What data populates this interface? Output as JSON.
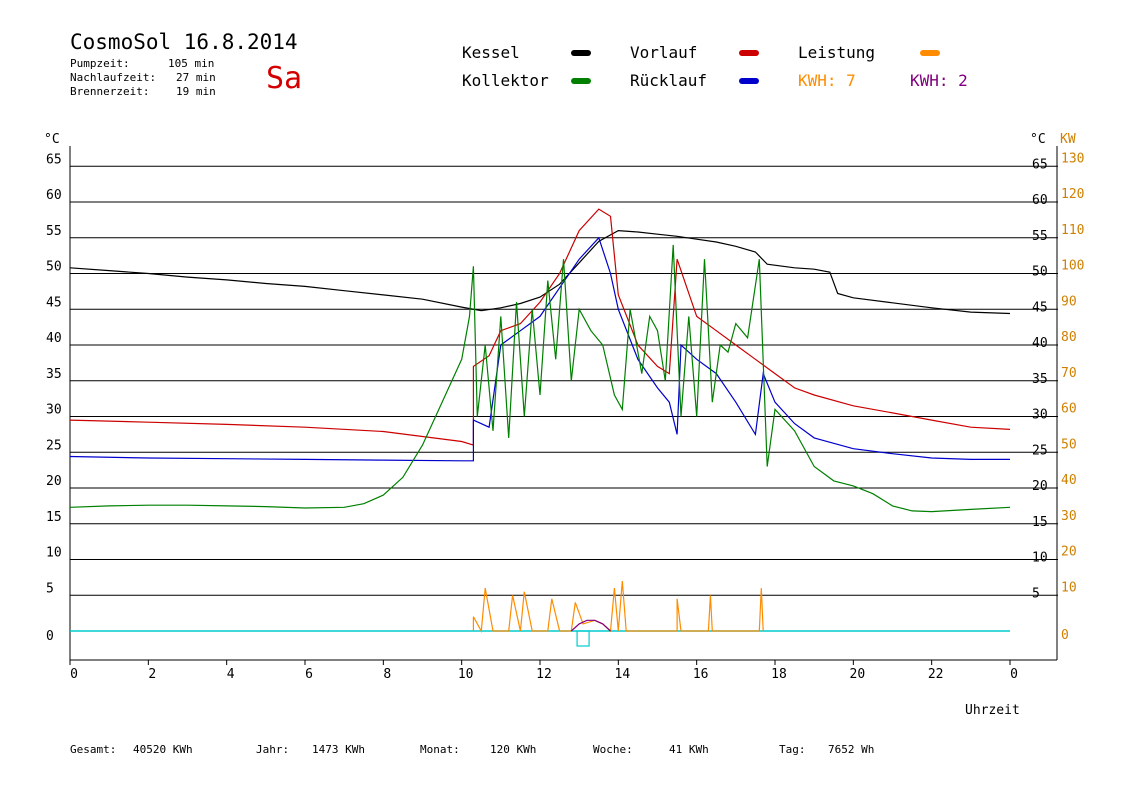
{
  "header": {
    "title": "CosmoSol 16.8.2014",
    "day": "Sa",
    "pump_label": "Pumpzeit:",
    "pump_value": "105 min",
    "after_label": "Nachlaufzeit:",
    "after_value": "27 min",
    "burner_label": "Brennerzeit:",
    "burner_value": "19 min"
  },
  "legend": {
    "kessel": "Kessel",
    "kollektor": "Kollektor",
    "vorlauf": "Vorlauf",
    "ruecklauf": "Rücklauf",
    "leistung": "Leistung",
    "kwh1": "KWH: 7",
    "kwh2": "KWH: 2"
  },
  "colors": {
    "kessel": "#000000",
    "kollektor": "#008000",
    "vorlauf": "#cc0000",
    "ruecklauf": "#0000cc",
    "leistung": "#ff8c00",
    "kwh2": "#800080",
    "baseline": "#00cccc",
    "kw_axis": "#d08000"
  },
  "footer": {
    "gesamt_label": "Gesamt:",
    "gesamt_value": "40520 KWh",
    "jahr_label": "Jahr:",
    "jahr_value": "1473 KWh",
    "monat_label": "Monat:",
    "monat_value": "120 KWh",
    "woche_label": "Woche:",
    "woche_value": "41 KWh",
    "tag_label": "Tag:",
    "tag_value": "7652 Wh"
  },
  "chart_data": {
    "type": "line",
    "xlabel": "Uhrzeit",
    "ylabel_left": "°C",
    "ylabel_right_temp": "°C",
    "ylabel_right_power": "KW",
    "xlim": [
      0,
      24
    ],
    "ylim": [
      -5,
      70
    ],
    "x_ticks": [
      "0",
      "2",
      "4",
      "6",
      "8",
      "10",
      "12",
      "14",
      "16",
      "18",
      "20",
      "22",
      "0"
    ],
    "y_ticks_left": [
      0,
      5,
      10,
      15,
      20,
      25,
      30,
      35,
      40,
      45,
      50,
      55,
      60,
      65
    ],
    "y_ticks_right_temp": [
      5,
      10,
      15,
      20,
      25,
      30,
      35,
      40,
      45,
      50,
      55,
      60,
      65
    ],
    "y_ticks_right_power": [
      0,
      10,
      20,
      30,
      40,
      50,
      60,
      70,
      80,
      90,
      100,
      110,
      120,
      130
    ],
    "grid": true,
    "series": [
      {
        "name": "Kessel",
        "color": "#000000",
        "points": [
          [
            0,
            50.8
          ],
          [
            1,
            50.4
          ],
          [
            2,
            50.0
          ],
          [
            3,
            49.5
          ],
          [
            4,
            49.1
          ],
          [
            5,
            48.6
          ],
          [
            6,
            48.2
          ],
          [
            7,
            47.6
          ],
          [
            8,
            47.0
          ],
          [
            9,
            46.4
          ],
          [
            10,
            45.3
          ],
          [
            10.5,
            44.8
          ],
          [
            11,
            45.2
          ],
          [
            11.5,
            45.8
          ],
          [
            12,
            46.7
          ],
          [
            12.5,
            48.5
          ],
          [
            13,
            51.5
          ],
          [
            13.5,
            54.5
          ],
          [
            14,
            56.0
          ],
          [
            14.5,
            55.8
          ],
          [
            15,
            55.5
          ],
          [
            15.5,
            55.2
          ],
          [
            16,
            54.8
          ],
          [
            16.5,
            54.4
          ],
          [
            17,
            53.8
          ],
          [
            17.5,
            53.0
          ],
          [
            17.8,
            51.3
          ],
          [
            18.5,
            50.8
          ],
          [
            19,
            50.6
          ],
          [
            19.4,
            50.2
          ],
          [
            19.6,
            47.2
          ],
          [
            20,
            46.6
          ],
          [
            21,
            45.9
          ],
          [
            22,
            45.2
          ],
          [
            23,
            44.6
          ],
          [
            24,
            44.4
          ]
        ]
      },
      {
        "name": "Vorlauf",
        "color": "#cc0000",
        "points": [
          [
            0,
            29.5
          ],
          [
            2,
            29.2
          ],
          [
            4,
            28.9
          ],
          [
            6,
            28.5
          ],
          [
            8,
            27.9
          ],
          [
            9,
            27.2
          ],
          [
            10,
            26.5
          ],
          [
            10.3,
            26.0
          ],
          [
            10.3,
            37.0
          ],
          [
            10.7,
            38.5
          ],
          [
            11,
            42
          ],
          [
            11.5,
            43
          ],
          [
            12,
            46
          ],
          [
            12.5,
            50
          ],
          [
            13,
            56
          ],
          [
            13.5,
            59
          ],
          [
            13.8,
            58
          ],
          [
            14,
            47
          ],
          [
            14.5,
            40
          ],
          [
            15,
            37
          ],
          [
            15.3,
            36
          ],
          [
            15.5,
            52
          ],
          [
            16,
            44
          ],
          [
            16.5,
            42
          ],
          [
            17,
            40
          ],
          [
            17.5,
            38
          ],
          [
            18,
            36
          ],
          [
            18.5,
            34
          ],
          [
            19,
            33
          ],
          [
            20,
            31.5
          ],
          [
            21,
            30.5
          ],
          [
            22,
            29.5
          ],
          [
            23,
            28.5
          ],
          [
            24,
            28.2
          ]
        ]
      },
      {
        "name": "Rücklauf",
        "color": "#0000cc",
        "points": [
          [
            0,
            24.4
          ],
          [
            2,
            24.2
          ],
          [
            4,
            24.1
          ],
          [
            6,
            24.0
          ],
          [
            8,
            23.9
          ],
          [
            10,
            23.8
          ],
          [
            10.3,
            23.8
          ],
          [
            10.3,
            29.5
          ],
          [
            10.7,
            28.5
          ],
          [
            11,
            40
          ],
          [
            11.5,
            42
          ],
          [
            12,
            44
          ],
          [
            12.5,
            48
          ],
          [
            13,
            52
          ],
          [
            13.5,
            55
          ],
          [
            13.8,
            50
          ],
          [
            14,
            45
          ],
          [
            14.5,
            38
          ],
          [
            15,
            34
          ],
          [
            15.3,
            32
          ],
          [
            15.5,
            27.5
          ],
          [
            15.6,
            40
          ],
          [
            16,
            38
          ],
          [
            16.5,
            36
          ],
          [
            17,
            32
          ],
          [
            17.5,
            27.5
          ],
          [
            17.7,
            36
          ],
          [
            18,
            32
          ],
          [
            18.5,
            29
          ],
          [
            19,
            27
          ],
          [
            20,
            25.5
          ],
          [
            21,
            24.8
          ],
          [
            22,
            24.2
          ],
          [
            23,
            24.0
          ],
          [
            24,
            24.0
          ]
        ]
      },
      {
        "name": "Kollektor",
        "color": "#008000",
        "points": [
          [
            0,
            17.3
          ],
          [
            1,
            17.5
          ],
          [
            2,
            17.6
          ],
          [
            3,
            17.6
          ],
          [
            4,
            17.5
          ],
          [
            5,
            17.4
          ],
          [
            6,
            17.2
          ],
          [
            7,
            17.3
          ],
          [
            7.5,
            17.8
          ],
          [
            8,
            19
          ],
          [
            8.5,
            21.5
          ],
          [
            9,
            26
          ],
          [
            9.5,
            32
          ],
          [
            10,
            38
          ],
          [
            10.2,
            44
          ],
          [
            10.3,
            51
          ],
          [
            10.4,
            30
          ],
          [
            10.6,
            40
          ],
          [
            10.8,
            28
          ],
          [
            11,
            44
          ],
          [
            11.2,
            27
          ],
          [
            11.4,
            46
          ],
          [
            11.6,
            30
          ],
          [
            11.8,
            45
          ],
          [
            12,
            33
          ],
          [
            12.2,
            49
          ],
          [
            12.4,
            38
          ],
          [
            12.6,
            52
          ],
          [
            12.8,
            35
          ],
          [
            13,
            45
          ],
          [
            13.3,
            42
          ],
          [
            13.6,
            40
          ],
          [
            13.9,
            33
          ],
          [
            14.1,
            31
          ],
          [
            14.3,
            45
          ],
          [
            14.6,
            36
          ],
          [
            14.8,
            44
          ],
          [
            15,
            42
          ],
          [
            15.2,
            35
          ],
          [
            15.4,
            54
          ],
          [
            15.6,
            30
          ],
          [
            15.8,
            44
          ],
          [
            16,
            30
          ],
          [
            16.2,
            52
          ],
          [
            16.4,
            32
          ],
          [
            16.6,
            40
          ],
          [
            16.8,
            39
          ],
          [
            17,
            43
          ],
          [
            17.3,
            41
          ],
          [
            17.6,
            52
          ],
          [
            17.8,
            23
          ],
          [
            18,
            31
          ],
          [
            18.5,
            28
          ],
          [
            19,
            23
          ],
          [
            19.5,
            21
          ],
          [
            20,
            20.3
          ],
          [
            20.5,
            19.2
          ],
          [
            21,
            17.5
          ],
          [
            21.5,
            16.8
          ],
          [
            22,
            16.7
          ],
          [
            23,
            17.0
          ],
          [
            24,
            17.3
          ]
        ]
      },
      {
        "name": "Leistung",
        "color": "#ff8c00",
        "axis": "right_power",
        "points": [
          [
            10.3,
            0
          ],
          [
            10.3,
            4
          ],
          [
            10.5,
            0
          ],
          [
            10.6,
            12
          ],
          [
            10.8,
            0
          ],
          [
            11.2,
            0
          ],
          [
            11.3,
            10
          ],
          [
            11.5,
            0
          ],
          [
            11.6,
            11
          ],
          [
            11.8,
            0
          ],
          [
            12.2,
            0
          ],
          [
            12.3,
            9
          ],
          [
            12.5,
            0
          ],
          [
            12.8,
            0
          ],
          [
            12.9,
            8
          ],
          [
            13.1,
            2
          ],
          [
            13.4,
            3
          ],
          [
            13.6,
            2
          ],
          [
            13.8,
            0
          ],
          [
            13.9,
            12
          ],
          [
            14,
            0
          ],
          [
            14.1,
            14
          ],
          [
            14.2,
            0
          ],
          [
            15.5,
            0
          ],
          [
            15.5,
            9
          ],
          [
            15.6,
            0
          ],
          [
            16.3,
            0
          ],
          [
            16.35,
            10
          ],
          [
            16.4,
            0
          ],
          [
            17.6,
            0
          ],
          [
            17.65,
            12
          ],
          [
            17.7,
            0
          ]
        ]
      },
      {
        "name": "KWH: 2",
        "color": "#800080",
        "axis": "right_power",
        "points": [
          [
            12.8,
            0
          ],
          [
            13.0,
            2
          ],
          [
            13.2,
            3
          ],
          [
            13.4,
            3
          ],
          [
            13.6,
            2
          ],
          [
            13.8,
            0
          ]
        ]
      }
    ]
  }
}
